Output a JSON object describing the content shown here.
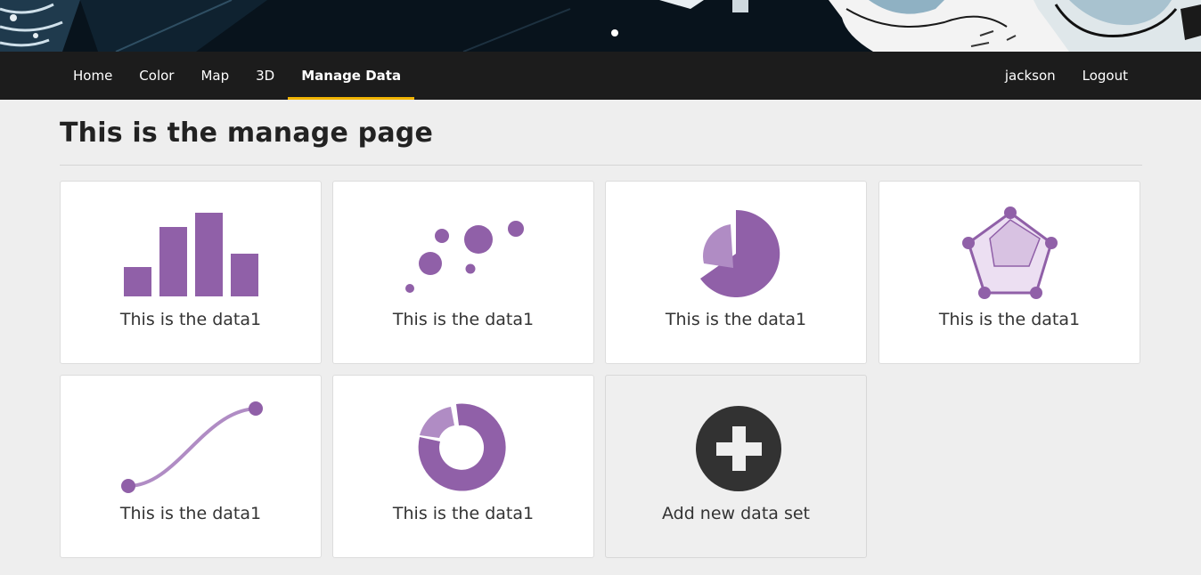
{
  "nav": {
    "left": [
      {
        "label": "Home",
        "active": false
      },
      {
        "label": "Color",
        "active": false
      },
      {
        "label": "Map",
        "active": false
      },
      {
        "label": "3D",
        "active": false
      },
      {
        "label": "Manage Data",
        "active": true
      }
    ],
    "right": [
      {
        "label": "jackson"
      },
      {
        "label": "Logout"
      }
    ]
  },
  "page": {
    "title": "This is the manage page"
  },
  "cards": [
    {
      "label": "This is the data1",
      "icon": "bar-chart-icon"
    },
    {
      "label": "This is the data1",
      "icon": "bubble-chart-icon"
    },
    {
      "label": "This is the data1",
      "icon": "pie-chart-icon"
    },
    {
      "label": "This is the data1",
      "icon": "radar-chart-icon"
    },
    {
      "label": "This is the data1",
      "icon": "line-chart-icon"
    },
    {
      "label": "This is the data1",
      "icon": "donut-chart-icon"
    },
    {
      "label": "Add new data set",
      "icon": "add-circle-icon"
    }
  ],
  "colors": {
    "accent": "#9060a8",
    "accent_light": "#b08cc4",
    "nav_bg": "#1c1c1c",
    "active_underline": "#f0b400",
    "page_bg": "#eeeeee"
  }
}
